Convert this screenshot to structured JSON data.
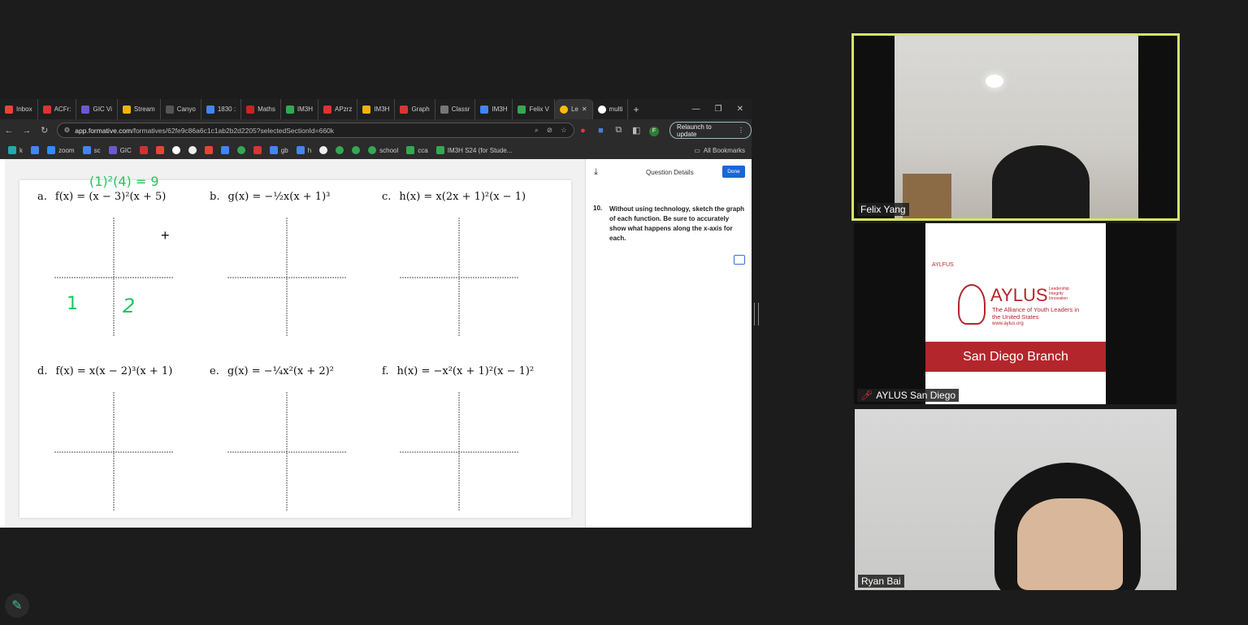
{
  "browser": {
    "tabs": [
      "Inbox",
      "ACFr:",
      "GIC Vi",
      "Stream",
      "Canyo",
      "1830 :",
      "Maths",
      "IM3H",
      "APzrz",
      "IM3H",
      "Graph",
      "Classr",
      "IM3H",
      "Felix V",
      "Le",
      "multi"
    ],
    "url_host": "app.formative.com",
    "url_path": "/formatives/62fe9c86a6c1c1ab2b2d2205?selectedSectionId=660k",
    "relaunch_label": "Relaunch to update",
    "profile_initial": "F",
    "bookmarks": [
      "k",
      "zoom",
      "sc",
      "GIC",
      "gb",
      "h",
      "school",
      "cca",
      "IM3H S24 (for Stude..."
    ],
    "all_bookmarks": "All Bookmarks"
  },
  "worksheet": {
    "problems": [
      {
        "label": "a.",
        "formula": "f(x) = (x − 3)²(x + 5)"
      },
      {
        "label": "b.",
        "formula": "g(x) = −½x(x + 1)³"
      },
      {
        "label": "c.",
        "formula": "h(x) = x(2x + 1)²(x − 1)"
      },
      {
        "label": "d.",
        "formula": "f(x) = x(x − 2)³(x + 1)"
      },
      {
        "label": "e.",
        "formula": "g(x) = −¼x²(x + 2)²"
      },
      {
        "label": "f.",
        "formula": "h(x) = −x²(x + 1)²(x − 1)²"
      }
    ],
    "handwriting": {
      "top": "(1)²(4) = 9",
      "n1": "1",
      "n2": "2"
    }
  },
  "panel": {
    "title": "Question Details",
    "done_label": "Done",
    "question_number": "10.",
    "question_text": "Without using technology, sketch the graph of each function. Be sure to accurately show what happens along the x-axis for each."
  },
  "participants": [
    {
      "name": "Felix Yang"
    },
    {
      "name": "AYLUS San Diego",
      "logo_small": "AYLFUS",
      "logo_title": "AYLUS",
      "tagline": [
        "Leadership",
        "Integrity",
        "Innovation"
      ],
      "org_name": "The Alliance of Youth Leaders in the United States",
      "website": "www.aylus.org",
      "branch": "San Diego Branch"
    },
    {
      "name": "Ryan Bai"
    }
  ],
  "colors": {
    "accent": "#1a66d6",
    "speaker_border": "#d8e36a",
    "aylus_red": "#b3262c",
    "ink": "#22c55e"
  }
}
